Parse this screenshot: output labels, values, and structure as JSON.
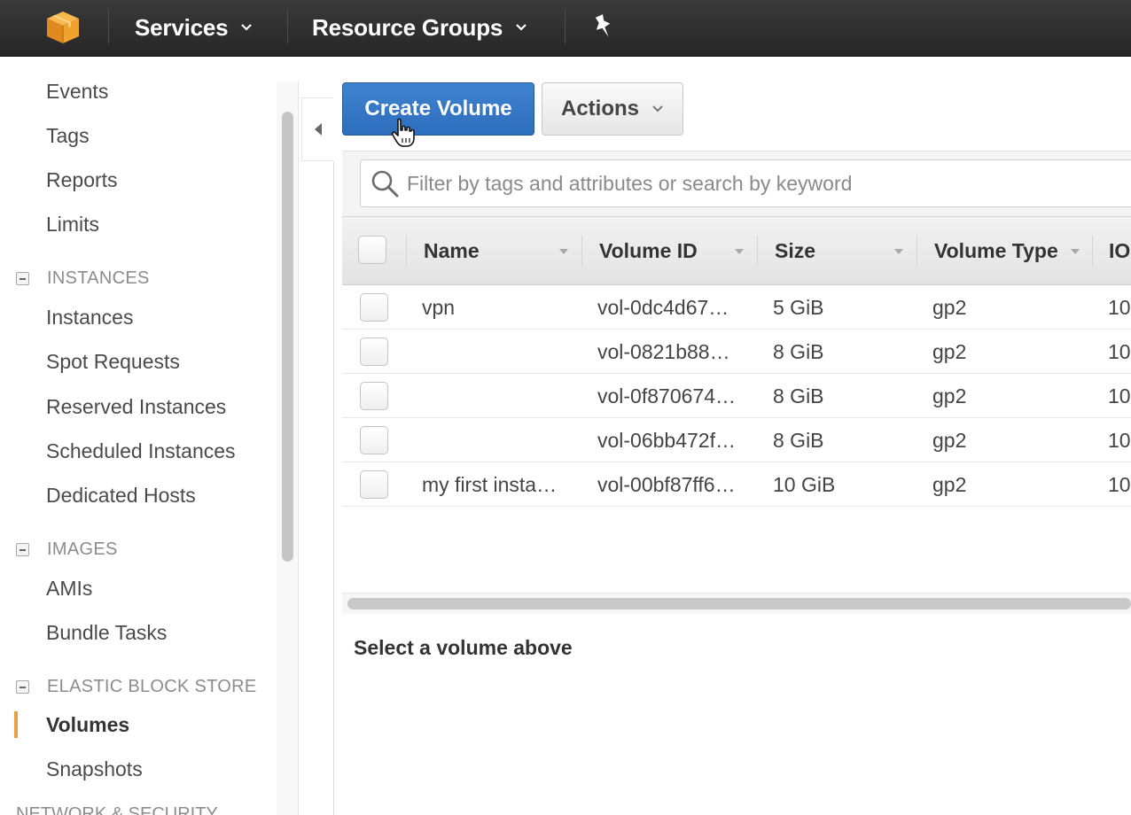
{
  "topbar": {
    "services_label": "Services",
    "resource_groups_label": "Resource Groups"
  },
  "sidebar": {
    "items_top": [
      {
        "label": "Events"
      },
      {
        "label": "Tags"
      },
      {
        "label": "Reports"
      },
      {
        "label": "Limits"
      }
    ],
    "sections": [
      {
        "header": "INSTANCES",
        "items": [
          {
            "label": "Instances"
          },
          {
            "label": "Spot Requests"
          },
          {
            "label": "Reserved Instances"
          },
          {
            "label": "Scheduled Instances"
          },
          {
            "label": "Dedicated Hosts"
          }
        ]
      },
      {
        "header": "IMAGES",
        "items": [
          {
            "label": "AMIs"
          },
          {
            "label": "Bundle Tasks"
          }
        ]
      },
      {
        "header": "ELASTIC BLOCK STORE",
        "items": [
          {
            "label": "Volumes",
            "active": true
          },
          {
            "label": "Snapshots"
          }
        ]
      }
    ],
    "partial_header": "NETWORK & SECURITY"
  },
  "toolbar": {
    "create_label": "Create Volume",
    "actions_label": "Actions"
  },
  "search": {
    "placeholder": "Filter by tags and attributes or search by keyword"
  },
  "table": {
    "columns": [
      "Name",
      "Volume ID",
      "Size",
      "Volume Type",
      "IO"
    ],
    "rows": [
      {
        "name": "vpn",
        "volume_id": "vol-0dc4d67…",
        "size": "5 GiB",
        "type": "gp2",
        "iops": "10"
      },
      {
        "name": "",
        "volume_id": "vol-0821b88…",
        "size": "8 GiB",
        "type": "gp2",
        "iops": "10"
      },
      {
        "name": "",
        "volume_id": "vol-0f870674…",
        "size": "8 GiB",
        "type": "gp2",
        "iops": "10"
      },
      {
        "name": "",
        "volume_id": "vol-06bb472f…",
        "size": "8 GiB",
        "type": "gp2",
        "iops": "10"
      },
      {
        "name": "my first insta…",
        "volume_id": "vol-00bf87ff6…",
        "size": "10 GiB",
        "type": "gp2",
        "iops": "10"
      }
    ]
  },
  "details": {
    "empty_label": "Select a volume above"
  },
  "colors": {
    "topbar": "#2f2f2f",
    "primary_button": "#3a7bc8",
    "active_marker": "#e7a33d",
    "logo_orange": "#f0a22e"
  },
  "icons": {
    "logo": "aws-cube-icon",
    "pin": "pin-icon",
    "search": "magnifier-icon",
    "collapse": "triangle-left-icon",
    "cursor": "hand-pointer-icon"
  }
}
